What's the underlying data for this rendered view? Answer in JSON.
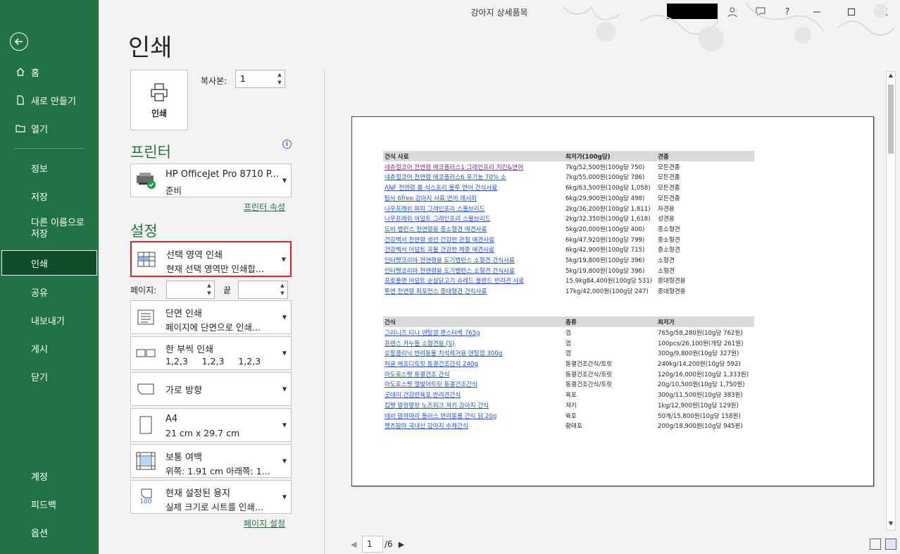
{
  "window": {
    "title": "강아지 상세품목"
  },
  "titlebar_icons": [
    "user-icon",
    "feedback-icon",
    "help-icon",
    "minimize-icon",
    "maximize-icon",
    "close-icon"
  ],
  "sidebar": {
    "top_items": [
      {
        "label": "홈",
        "icon": "home-icon"
      },
      {
        "label": "새로 만들기",
        "icon": "new-document-icon"
      },
      {
        "label": "열기",
        "icon": "open-folder-icon"
      }
    ],
    "info": "정보",
    "save": "저장",
    "save_as_line1": "다른 이름으로",
    "save_as_line2": "저장",
    "print": "인쇄",
    "share": "공유",
    "export": "내보내기",
    "publish": "게시",
    "close": "닫기",
    "account": "계정",
    "feedback": "피드백",
    "options": "옵션"
  },
  "heading": "인쇄",
  "print_button": "인쇄",
  "copies": {
    "label": "복사본:",
    "value": "1"
  },
  "printer": {
    "section_title": "프린터",
    "name": "HP OfficeJet Pro 8710 P...",
    "status": "준비",
    "properties_link": "프린터 속성"
  },
  "settings": {
    "section_title": "설정",
    "print_area": {
      "line1": "선택 영역 인쇄",
      "line2": "현재 선택 영역만 인쇄합..."
    },
    "pages_label": "페이지:",
    "end_label": "끝",
    "pages_from": "",
    "pages_to": "",
    "sides": {
      "line1": "단면 인쇄",
      "line2": "페이지에 단면으로 인쇄..."
    },
    "collate": {
      "line1": "한 부씩 인쇄",
      "line2": "1,2,3     1,2,3     1,2,3"
    },
    "orientation": {
      "line1": "가로 방향"
    },
    "paper": {
      "line1": "A4",
      "line2": "21 cm x 29.7 cm"
    },
    "margins": {
      "line1": "보통 여백",
      "line2": "위쪽: 1.91 cm 아래쪽: 1..."
    },
    "scaling": {
      "line1": "현재 설정된 용지",
      "line2": "실제 크기로 시트를 인쇄...",
      "icon_text": "100"
    },
    "page_setup_link": "페이지 설정"
  },
  "preview": {
    "current_page": "1",
    "total_pages": "/6",
    "sheet": {
      "table1_headers": [
        "건식 사료",
        "최저가(100g당)",
        "견종"
      ],
      "table1_rows": [
        [
          "네츄럴코어 전연령 에코플러스1 그레인프리 치킨&연어",
          "7kg/52,500원(100g당 750)",
          "모든견종"
        ],
        [
          "네츄럴코어 전연령 에코플러스6 유기농 70% 소",
          "7kg/55,000원(100g당 786)",
          "모든견종"
        ],
        [
          "ANF 전연령 룸 식스프리 볼루 연어 건식사료",
          "6kg/63,500원(100g당 1,058)",
          "모든견종"
        ],
        [
          "탐사 6free 강아지 사료 연어 레시피",
          "6kg/29,900원(100g당 498)",
          "모든견종"
        ],
        [
          "나우프레쉬 퍼피 그레인프리 스몰브리드",
          "2kg/36,200원(100g당 1,811)",
          "자견용"
        ],
        [
          "나우프레쉬 어덜트 그레인프리 스몰브리드",
          "2kg/32,350원(100g당 1,618)",
          "성견용"
        ],
        [
          "도비 밸런스 전연령용 중소형견 애견사료",
          "5kg/20,000원(100g당 400)",
          "중소형견"
        ],
        [
          "건강백서 전연령 생선 건강한 관절 애견사료",
          "6kg/47,920원(100g당 799)",
          "중소형견"
        ],
        [
          "건강백서 어덜트 곡물 건강한 체중 애견사료",
          "6kg/42,900원(100g당 715)",
          "중소형견"
        ],
        [
          "인터펫코리아 전연령용 도기밸런스 소형견 건식사료",
          "5kg/19,800원(100g당 396)",
          "소형견"
        ],
        [
          "인터펫코리아 전연령용 도기밸런스 소형견 건식사료",
          "5kg/19,800원(100g당 396)",
          "소형견"
        ],
        [
          "프로플랜 어덜트 순살닭고기 슈레드 블렌드 반려견 사료",
          "15.9kg84,400원(100g당 531)",
          "중대형견용"
        ],
        [
          "투엔 전연령 퍼포먼스 중대형견 건식사료",
          "17kg/42,000원(100g당 247)",
          "중대형견용"
        ]
      ],
      "table2_headers": [
        "간식",
        "종류",
        "최저가"
      ],
      "table2_rows": [
        [
          "그리니즈 티니 덴탈껌 몬스터백 765g",
          "껌",
          "765g/58,280원(10g당 762원)"
        ],
        [
          "프렌스 카누들 소형견용 (S)",
          "껌",
          "100pcs/26,100원(개당 261원)"
        ],
        [
          "오랄클리닉 반려동물 치석제거용 덴탈껌 300g",
          "껌",
          "300g/9,800원(10g당 327원)"
        ],
        [
          "허글 에프디트릿 동결건조간식 240g",
          "동결건조간식/트릿",
          "240kg/14,200원(10g당 592)"
        ],
        [
          "마도로스펫 동결건조 간식",
          "동결건조간식/트릿",
          "120g/16,000원(10g당 1,333원)"
        ],
        [
          "마도로스펫 엘빛어트릿 동결건조간식",
          "동결건조간식/트릿",
          "20g/10,500원(10g당 1,750원)"
        ],
        [
          "굿데이 건강한육포 반려견간식",
          "육포",
          "300g/11,500원(10g당 383원)"
        ],
        [
          "킵펫 말랑말랑 노즈워크 져키 강아지 간식",
          "져키",
          "1kg/12,900원(10g당 129원)"
        ],
        [
          "테비 맘하마리 플러스 반려동물 간식 닭 20g",
          "육포",
          "50개/15,800원(10g당 158원)"
        ],
        [
          "펫츠맘마 국내산 강아지 수제간식",
          "황태포",
          "200g/18,900원(10g당 945원)"
        ]
      ]
    }
  },
  "colors": {
    "accent": "#217346",
    "highlight": "#e8202a",
    "link": "#1f55c8"
  }
}
